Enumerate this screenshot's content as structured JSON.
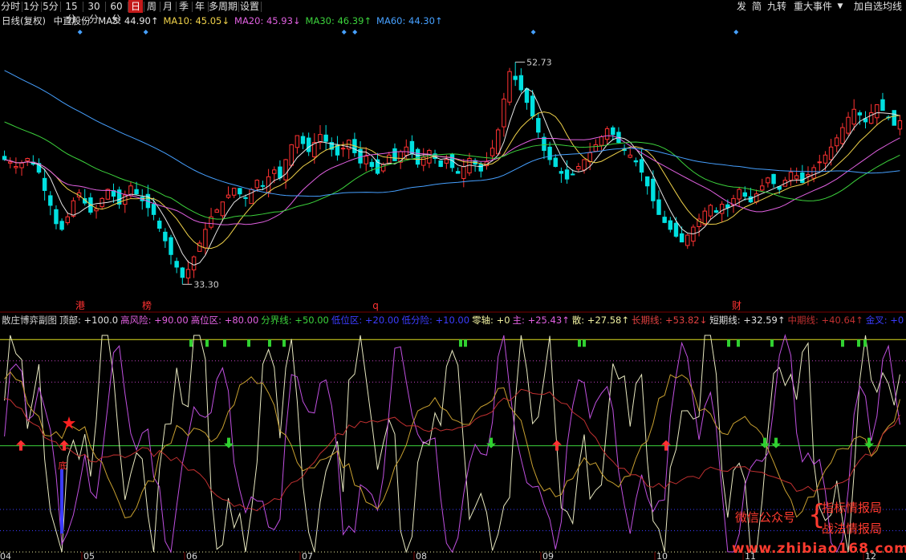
{
  "toolbar": {
    "left": [
      "分时",
      "1分",
      "5分",
      "15分",
      "30分",
      "60分",
      "日",
      "周",
      "月",
      "季",
      "年",
      "多周期",
      "设置"
    ],
    "selected": "日",
    "right": [
      "发",
      "简",
      "九转",
      "重大事件",
      "加自选",
      "均线"
    ],
    "menu_arrow": "▼"
  },
  "main_legend": {
    "period": "日线(复权)",
    "name": "中直股份",
    "ma": [
      {
        "label": "MA5: 44.90↑",
        "color": "#e6e6e6"
      },
      {
        "label": "MA10: 45.05↓",
        "color": "#f0d24a"
      },
      {
        "label": "MA20: 45.93↓",
        "color": "#e060e0"
      },
      {
        "label": "MA30: 46.39↑",
        "color": "#3cd23c"
      },
      {
        "label": "MA60: 44.30↑",
        "color": "#46a0ff"
      }
    ]
  },
  "sub_legend": [
    {
      "label": "散庄博弈副图",
      "color": "#d0d0d0"
    },
    {
      "label": "顶部: +100.0",
      "color": "#e0e0e0"
    },
    {
      "label": "高风险: +90.00",
      "color": "#e060e0"
    },
    {
      "label": "高位区: +80.00",
      "color": "#e060e0"
    },
    {
      "label": "分界线: +50.00",
      "color": "#3cd23c"
    },
    {
      "label": "低位区: +20.00",
      "color": "#3c3cff"
    },
    {
      "label": "低分险: +10.00",
      "color": "#3c3cff"
    },
    {
      "label": "零轴: +0",
      "color": "#f0f0a0"
    },
    {
      "label": "主: +25.43↑",
      "color": "#e060e0"
    },
    {
      "label": "散: +27.58↑",
      "color": "#f0f0a0"
    },
    {
      "label": "长期线: +53.82↓",
      "color": "#e04040"
    },
    {
      "label": "短期线: +32.59↑",
      "color": "#e0e0e0"
    },
    {
      "label": "中期线: +40.64↑",
      "color": "#c03030"
    },
    {
      "label": "金叉: +0",
      "color": "#3c3cff"
    }
  ],
  "watermark": {
    "left": "微信公众号",
    "brace": "{",
    "right1": "指标情报局",
    "right2": "战法情报局",
    "url": "www.zhibiao168.com"
  },
  "colors": {
    "up": "#ff3232",
    "down": "#00e0e0",
    "ma5": "#e6e6e6",
    "ma10": "#f0d24a",
    "ma20": "#e060e0",
    "ma30": "#3cd23c",
    "ma60": "#46a0ff"
  },
  "chart_data": [
    {
      "type": "candlestick",
      "title": "日线(复权) 中直股份",
      "x_months": [
        "04",
        "05",
        "06",
        "07",
        "08",
        "09",
        "10",
        "11",
        "12"
      ],
      "price_annotations": [
        {
          "label": "52.73",
          "kind": "high"
        },
        {
          "label": "33.30",
          "kind": "low"
        }
      ],
      "event_markers": [
        {
          "label": "港",
          "month": "05"
        },
        {
          "label": "榜",
          "month": "05"
        },
        {
          "label": "q",
          "month": "07"
        },
        {
          "label": "财",
          "month": "10"
        }
      ],
      "closes": [
        44.2,
        44.0,
        43.6,
        43.9,
        44.3,
        43.8,
        43.1,
        41.5,
        40.2,
        38.6,
        38.1,
        39.2,
        40.6,
        41.3,
        40.4,
        39.6,
        39.9,
        40.8,
        41.6,
        41.0,
        40.3,
        41.1,
        41.9,
        41.2,
        40.6,
        40.0,
        39.4,
        38.2,
        37.1,
        35.9,
        34.8,
        33.9,
        34.6,
        35.7,
        36.9,
        38.1,
        39.2,
        39.8,
        40.5,
        41.1,
        41.7,
        41.2,
        40.8,
        41.6,
        42.4,
        41.9,
        42.7,
        43.3,
        42.6,
        44.2,
        45.5,
        46.3,
        45.6,
        44.9,
        45.7,
        46.4,
        45.8,
        45.1,
        44.6,
        45.2,
        45.9,
        44.8,
        43.9,
        44.5,
        43.6,
        43.0,
        43.8,
        44.6,
        44.1,
        44.9,
        45.3,
        44.7,
        43.8,
        44.4,
        45.0,
        44.3,
        43.6,
        44.2,
        43.5,
        43.0,
        43.6,
        44.3,
        43.8,
        43.2,
        44.0,
        45.2,
        46.8,
        49.5,
        51.9,
        51.2,
        50.3,
        49.2,
        48.0,
        46.6,
        45.0,
        44.2,
        43.6,
        43.0,
        42.5,
        42.9,
        43.6,
        44.2,
        44.8,
        45.5,
        46.2,
        46.9,
        46.4,
        45.7,
        45.0,
        44.6,
        44.0,
        43.1,
        41.9,
        40.6,
        39.4,
        38.7,
        38.1,
        37.5,
        37.0,
        37.6,
        38.3,
        39.0,
        39.7,
        40.2,
        39.6,
        40.3,
        40.0,
        40.8,
        41.6,
        41.0,
        40.5,
        41.2,
        41.9,
        42.6,
        42.1,
        41.6,
        42.4,
        43.1,
        42.8,
        42.2,
        42.9,
        43.5,
        44.0,
        44.6,
        45.3,
        46.1,
        47.0,
        47.9,
        48.6,
        48.1,
        47.5,
        48.3,
        49.0,
        48.5,
        47.9,
        47.2,
        47.6
      ],
      "ma_current": {
        "MA5": 44.9,
        "MA10": 45.05,
        "MA20": 45.93,
        "MA30": 46.39,
        "MA60": 44.3
      }
    },
    {
      "type": "line",
      "title": "散庄博弈副图",
      "levels": [
        {
          "name": "顶部",
          "value": 100,
          "color": "#e0e020"
        },
        {
          "name": "高风险",
          "value": 90,
          "color": "#c040c0"
        },
        {
          "name": "高位区",
          "value": 80,
          "color": "#c040c0"
        },
        {
          "name": "分界线",
          "value": 50,
          "color": "#3cd23c"
        },
        {
          "name": "低位区",
          "value": 20,
          "color": "#3c3cff"
        },
        {
          "name": "低分险",
          "value": 10,
          "color": "#3c3cff"
        },
        {
          "name": "零轴",
          "value": 0,
          "color": "#f0f0a0"
        }
      ],
      "ylim": [
        0,
        105
      ],
      "series_current": {
        "主": 25.43,
        "散": 27.58,
        "长期线": 53.82,
        "短期线": 32.59,
        "中期线": 40.64,
        "金叉": 0
      },
      "signal_markers": {
        "bottom_label": "底"
      }
    }
  ]
}
